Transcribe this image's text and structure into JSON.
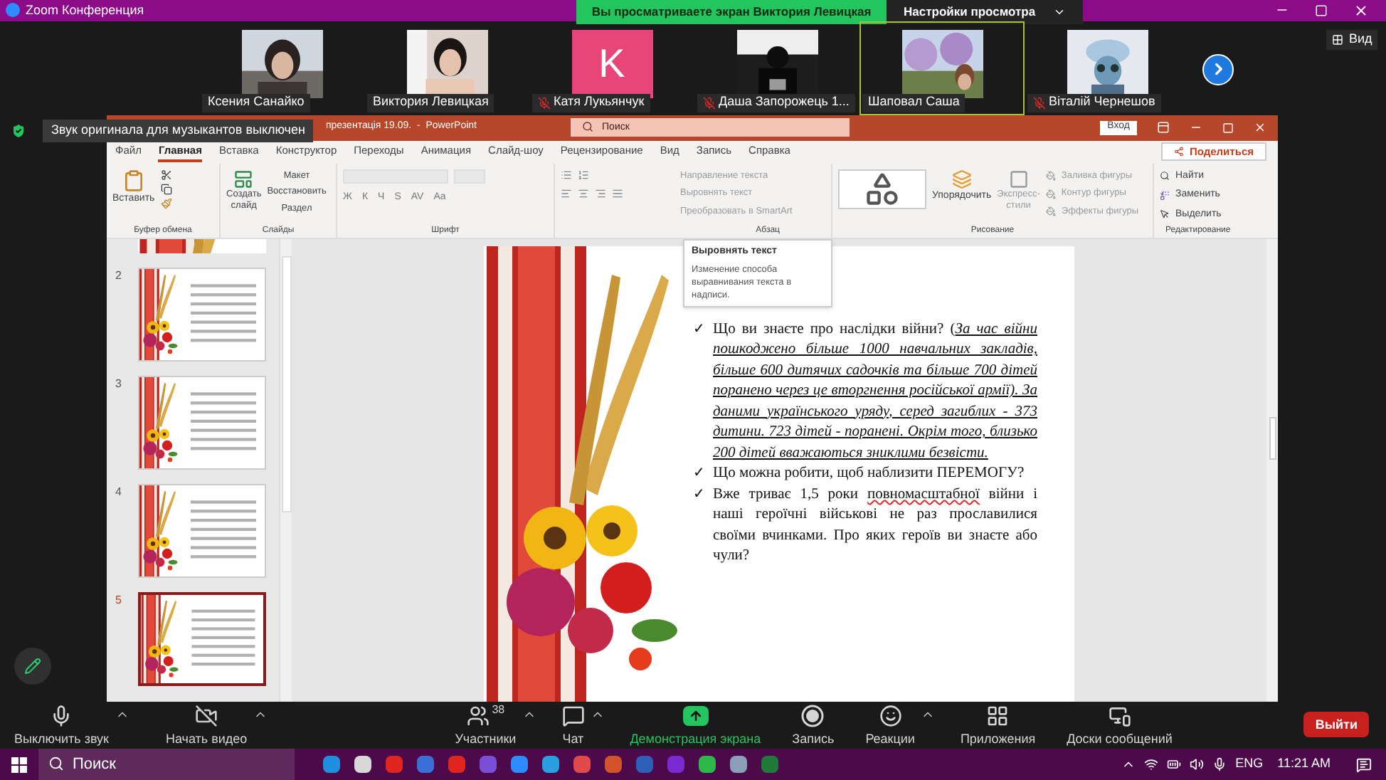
{
  "window": {
    "title": "Zoom Конференция"
  },
  "share_banner": {
    "text": "Вы просматриваете экран Виктория Левицкая",
    "view_settings": "Настройки просмотра"
  },
  "participants": [
    {
      "name": "Ксения Санайко",
      "kind": "video",
      "muted": false,
      "speaking": false
    },
    {
      "name": "Виктория Левицкая",
      "kind": "video",
      "muted": false,
      "speaking": false
    },
    {
      "name": "Катя Лукьянчук",
      "kind": "initial",
      "initial": "K",
      "color": "#e8457a",
      "muted": true,
      "speaking": false
    },
    {
      "name": "Даша Запорожець 1...",
      "kind": "video",
      "muted": true,
      "speaking": false
    },
    {
      "name": "Шаповал Саша",
      "kind": "video",
      "muted": false,
      "speaking": true
    },
    {
      "name": "Віталій Чернешов",
      "kind": "video",
      "muted": true,
      "speaking": false
    }
  ],
  "view_button": "Вид",
  "notification": "Звук оригинала для музыкантов выключен",
  "powerpoint": {
    "title": "презентація 19.09.  -  PowerPoint",
    "search_placeholder": "Поиск",
    "login": "Вход",
    "share": "Поделиться",
    "tabs": [
      {
        "label": "Файл",
        "selected": false
      },
      {
        "label": "Главная",
        "selected": true
      },
      {
        "label": "Вставка",
        "selected": false
      },
      {
        "label": "Конструктор",
        "selected": false
      },
      {
        "label": "Переходы",
        "selected": false
      },
      {
        "label": "Анимация",
        "selected": false
      },
      {
        "label": "Слайд-шоу",
        "selected": false
      },
      {
        "label": "Рецензирование",
        "selected": false
      },
      {
        "label": "Вид",
        "selected": false
      },
      {
        "label": "Запись",
        "selected": false
      },
      {
        "label": "Справка",
        "selected": false
      }
    ],
    "ribbon": {
      "clipboard": {
        "label": "Буфер обмена",
        "paste": "Вставить"
      },
      "slides": {
        "label": "Слайды",
        "new_slide": [
          "Создать",
          "слайд"
        ],
        "layout": "Макет",
        "reset": "Восстановить",
        "section": "Раздел"
      },
      "font": {
        "label": "Шрифт",
        "format_buttons": [
          "Ж",
          "К",
          "Ч",
          "S",
          "AV",
          "Aa"
        ]
      },
      "paragraph": {
        "label": "Абзац",
        "commands": [
          "Направление текста",
          "Выровнять текст",
          "Преобразовать в SmartArt"
        ]
      },
      "drawing": {
        "label": "Рисование",
        "arrange": "Упорядочить",
        "quick_styles": [
          "Экспресс-",
          "стили"
        ],
        "commands": [
          "Заливка фигуры",
          "Контур фигуры",
          "Эффекты фигуры"
        ]
      },
      "editing": {
        "label": "Редактирование",
        "commands": [
          "Найти",
          "Заменить",
          "Выделить"
        ]
      }
    },
    "tooltip": {
      "title": "Выровнять текст",
      "text": "Изменение способа выравнивания текста в надписи."
    },
    "thumbnails": [
      {
        "number": "2",
        "selected": false
      },
      {
        "number": "3",
        "selected": false
      },
      {
        "number": "4",
        "selected": false
      },
      {
        "number": "5",
        "selected": true
      }
    ],
    "slide": {
      "bullets": [
        {
          "marker": "✓",
          "parts": [
            {
              "kind": "plain",
              "text": "Що ви знаєте про наслідки війни? ("
            },
            {
              "kind": "emphasis",
              "text": "За час війни пошкоджено більше 1000 навчальних закладів, більше 600 дитячих садочків  та  більше 700 дітей поранено через це  вторгнення російської армії). За даними українського уряду, серед загиблих - 373 дитини. 723 дітей - поранені. Окрім того, близько 200 дітей вважаються зниклими безвісти."
            }
          ]
        },
        {
          "marker": "✓",
          "parts": [
            {
              "kind": "plain",
              "text": "Що можна робити, щоб  наблизити ПЕРЕМОГУ?"
            }
          ]
        },
        {
          "marker": "✓",
          "parts": [
            {
              "kind": "plain",
              "text": "Вже триває 1,5 роки "
            },
            {
              "kind": "misspelled",
              "text": "повномасштабної"
            },
            {
              "kind": "plain",
              "text": " війни і наші героїчні військові не раз прославилися своїми вчинками. Про яких героїв ви знаєте або чули?"
            }
          ]
        }
      ]
    }
  },
  "toolbar": [
    {
      "kind": "mic",
      "label": "Выключить звук",
      "caret": true,
      "active": false
    },
    {
      "kind": "video",
      "label": "Начать видео",
      "caret": true,
      "active": false
    },
    {
      "kind": "participants",
      "label": "Участники",
      "count": "38",
      "caret": true,
      "active": false
    },
    {
      "kind": "chat",
      "label": "Чат",
      "caret": true,
      "active": false
    },
    {
      "kind": "share",
      "label": "Демонстрация экрана",
      "caret": false,
      "active": true
    },
    {
      "kind": "record",
      "label": "Запись",
      "caret": false,
      "active": false
    },
    {
      "kind": "reactions",
      "label": "Реакции",
      "caret": true,
      "active": false
    },
    {
      "kind": "apps",
      "label": "Приложения",
      "caret": false,
      "active": false
    },
    {
      "kind": "boards",
      "label": "Доски сообщений",
      "caret": false,
      "active": false
    }
  ],
  "leave_button": "Выйти",
  "taskbar": {
    "search_placeholder": "Поиск",
    "language": "ENG",
    "time": "11:21 AM"
  }
}
